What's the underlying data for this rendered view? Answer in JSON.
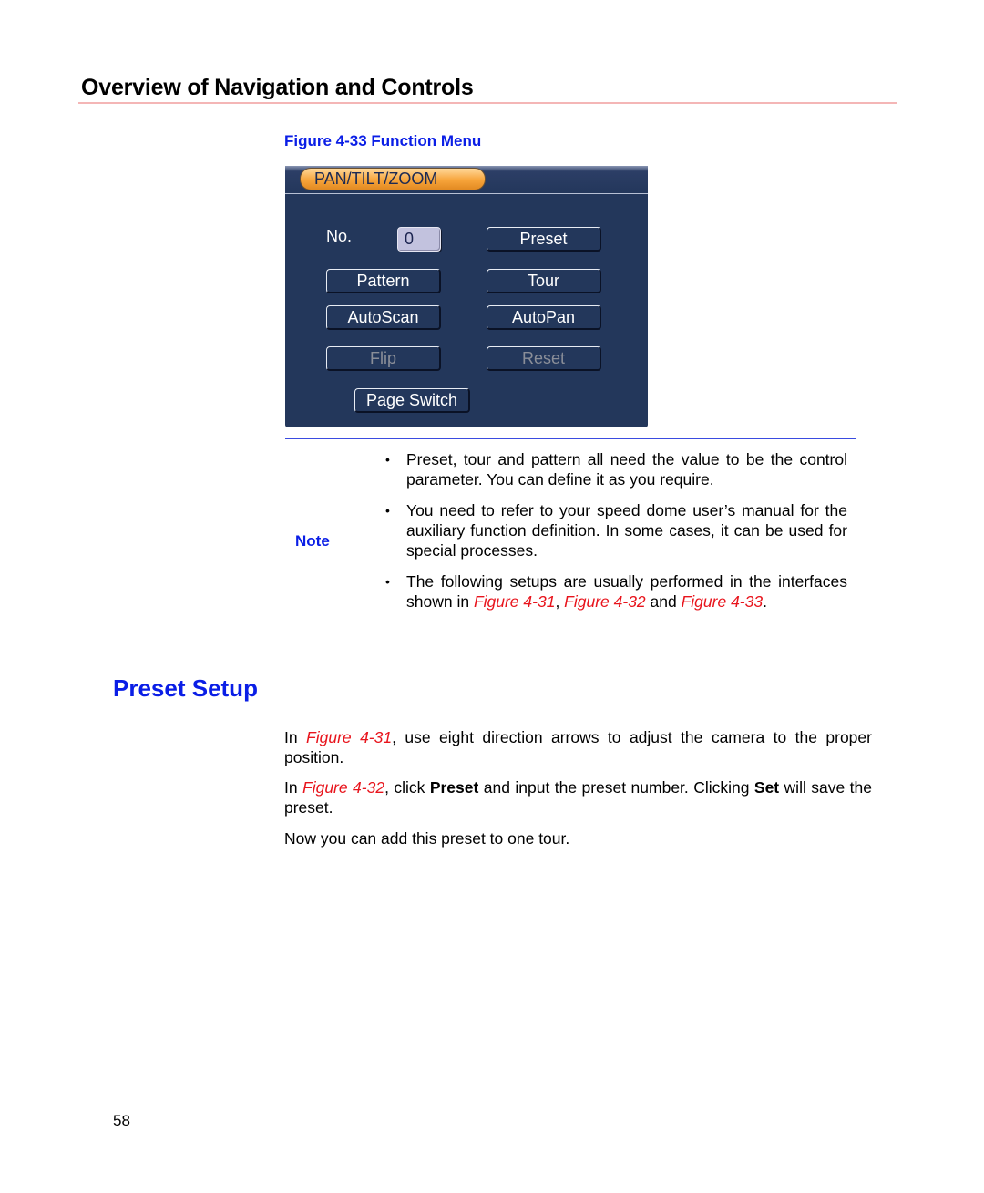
{
  "header": {
    "chapter_title": "Overview of Navigation and Controls"
  },
  "figure": {
    "caption": "Figure 4-33 Function Menu",
    "panel": {
      "tab_title": "PAN/TILT/ZOOM",
      "no_label": "No.",
      "no_value": "0",
      "buttons": {
        "preset": "Preset",
        "pattern": "Pattern",
        "tour": "Tour",
        "autoscan": "AutoScan",
        "autopan": "AutoPan",
        "flip": "Flip",
        "reset": "Reset",
        "page_switch": "Page Switch"
      }
    }
  },
  "note": {
    "label": "Note",
    "bullet": "•",
    "items": [
      {
        "text": "Preset, tour and pattern all need the value to be the control parameter. You can define it as you require."
      },
      {
        "text": "You need to refer to your speed dome user’s manual for the auxiliary function definition. In some cases, it can be used for special processes."
      },
      {
        "pre": "The following setups are usually performed in the interfaces shown in ",
        "ref1": "Figure 4-31",
        "sep1": ", ",
        "ref2": "Figure 4-32",
        "sep2": " and ",
        "ref3": "Figure 4-33",
        "post": "."
      }
    ]
  },
  "section": {
    "title": "Preset Setup",
    "paragraphs": [
      {
        "pre": "In ",
        "ref": "Figure 4-31",
        "post": ", use eight direction arrows to adjust the camera to the proper position."
      },
      {
        "pre": "In ",
        "ref": "Figure 4-32",
        "mid1": ", click ",
        "bold1": "Preset",
        "mid2": " and input the preset number. Clicking ",
        "bold2": "Set",
        "post": " will save the preset."
      },
      {
        "text": "Now you can add this preset to one tour."
      }
    ]
  },
  "footer": {
    "page_number": "58"
  }
}
